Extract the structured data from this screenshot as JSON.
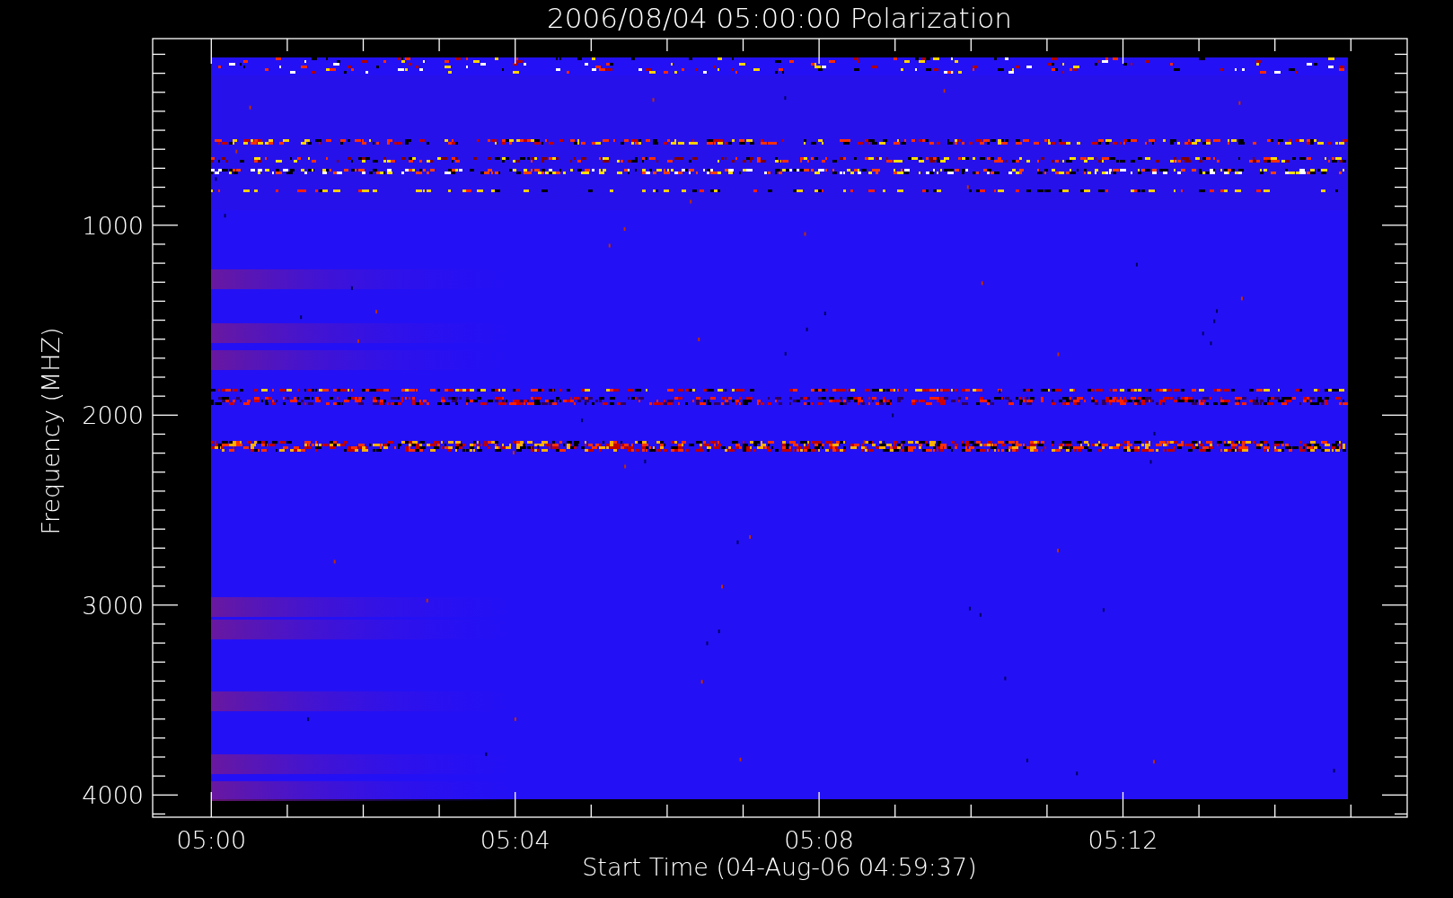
{
  "title": "2006/08/04 05:00:00 Polarization",
  "y_axis": {
    "label": "Frequency (MHZ)",
    "ticks": [
      "1000",
      "2000",
      "3000",
      "4000"
    ]
  },
  "x_axis": {
    "label": "Start Time (04-Aug-06 04:59:37)",
    "ticks": [
      "05:00",
      "05:04",
      "05:08",
      "05:12"
    ]
  }
}
